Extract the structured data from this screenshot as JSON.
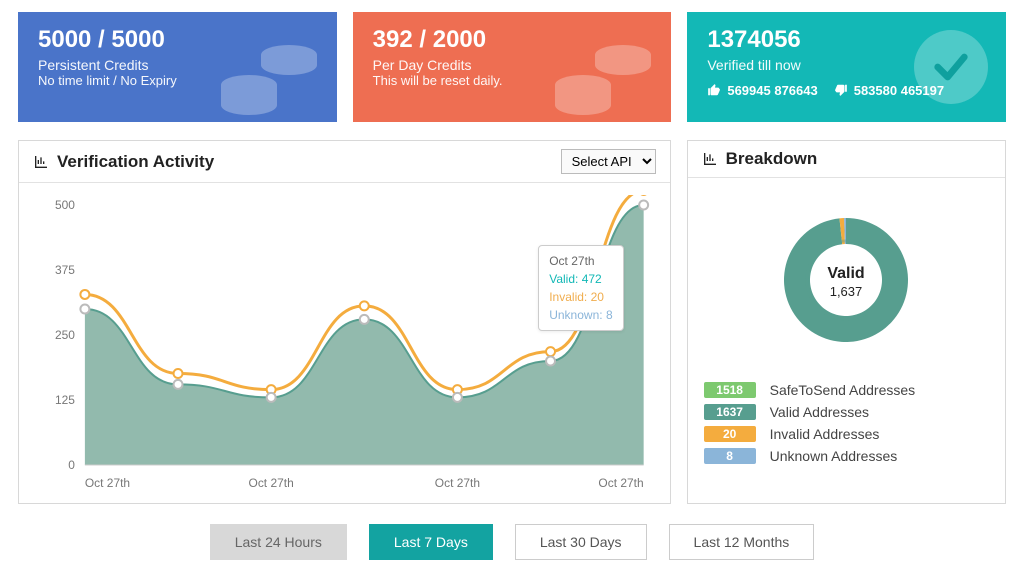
{
  "cards": {
    "persistent": {
      "value": "5000 / 5000",
      "line1": "Persistent Credits",
      "line2": "No time limit / No Expiry"
    },
    "perDay": {
      "value": "392 / 2000",
      "line1": "Per Day Credits",
      "line2": "This will be reset daily."
    },
    "verified": {
      "value": "1374056",
      "line1": "Verified till now",
      "thumbsUp": "569945 876643",
      "thumbsDown": "583580 465197"
    }
  },
  "activity": {
    "title": "Verification Activity",
    "apiSelect": "Select API",
    "tooltip": {
      "date": "Oct 27th",
      "valid_label": "Valid:",
      "valid": "472",
      "invalid_label": "Invalid:",
      "invalid": "20",
      "unknown_label": "Unknown:",
      "unknown": "8"
    }
  },
  "breakdown": {
    "title": "Breakdown",
    "center_label": "Valid",
    "center_value": "1,637",
    "legend": {
      "safe": {
        "count": "1518",
        "label": "SafeToSend Addresses"
      },
      "valid": {
        "count": "1637",
        "label": "Valid Addresses"
      },
      "invalid": {
        "count": "20",
        "label": "Invalid Addresses"
      },
      "unknown": {
        "count": "8",
        "label": "Unknown Addresses"
      }
    }
  },
  "ranges": {
    "h24": "Last 24 Hours",
    "d7": "Last 7 Days",
    "d30": "Last 30 Days",
    "m12": "Last 12 Months"
  },
  "chart_data": {
    "type": "area",
    "categories": [
      "Oct 27th",
      "Oct 27th",
      "Oct 27th",
      "Oct 27th",
      "Oct 27th",
      "Oct 27th",
      "Oct 27th"
    ],
    "series": [
      {
        "name": "Valid",
        "values": [
          300,
          155,
          130,
          280,
          130,
          200,
          500
        ]
      },
      {
        "name": "Invalid",
        "values": [
          20,
          15,
          10,
          18,
          10,
          12,
          20
        ]
      },
      {
        "name": "Unknown",
        "values": [
          8,
          6,
          5,
          8,
          5,
          6,
          8
        ]
      }
    ],
    "ylim": [
      0,
      500
    ],
    "yticks": [
      0,
      125,
      250,
      375,
      500
    ],
    "xlabel_ticks": [
      "Oct 27th",
      "Oct 27th",
      "Oct 27th",
      "Oct 27th"
    ],
    "title": "Verification Activity",
    "highlight_index": 6,
    "highlight_values": {
      "Valid": 472,
      "Invalid": 20,
      "Unknown": 8
    }
  }
}
